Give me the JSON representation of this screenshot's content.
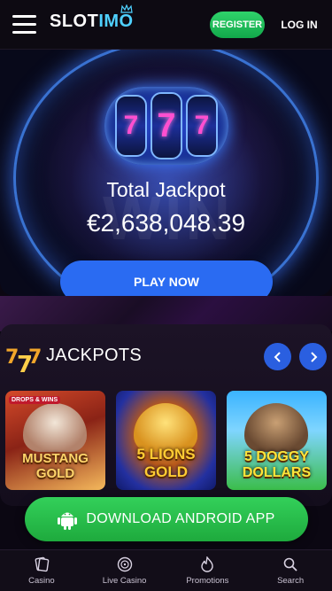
{
  "header": {
    "logo_text_white": "SLOT",
    "logo_text_blue": "IMO",
    "register_label": "REGISTER",
    "login_label": "LOG IN"
  },
  "hero": {
    "reels": [
      "7",
      "7",
      "7"
    ],
    "watermark": "WIN",
    "title": "Total Jackpot",
    "amount": "€2,638,048.39",
    "play_label": "PLAY NOW"
  },
  "jackpots": {
    "heading": "JACKPOTS",
    "games": [
      {
        "title": "MUSTANG GOLD",
        "badge": "DROPS & WINS"
      },
      {
        "title": "5 LIONS GOLD"
      },
      {
        "title": "5 DOGGY DOLLARS"
      }
    ]
  },
  "download": {
    "label": "DOWNLOAD ANDROID APP"
  },
  "nav": {
    "items": [
      {
        "label": "Casino",
        "icon": "cards-icon"
      },
      {
        "label": "Live Casino",
        "icon": "roulette-icon"
      },
      {
        "label": "Promotions",
        "icon": "flame-icon"
      },
      {
        "label": "Search",
        "icon": "search-icon"
      }
    ]
  },
  "colors": {
    "accent_blue": "#2a6bf2",
    "accent_green": "#1eaa3d",
    "brand_cyan": "#4fd1ff",
    "background": "#0b0712"
  }
}
